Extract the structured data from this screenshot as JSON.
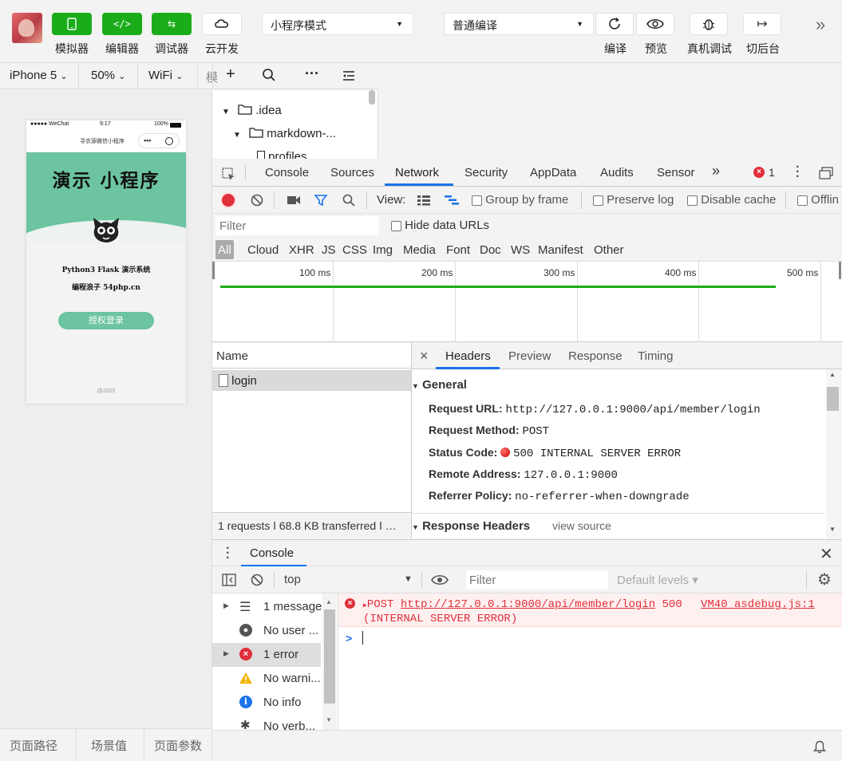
{
  "toolbar": {
    "buttons": [
      {
        "label": "模拟器",
        "icon": "phone-icon"
      },
      {
        "label": "编辑器",
        "icon": "code-icon"
      },
      {
        "label": "调试器",
        "icon": "sliders-icon"
      },
      {
        "label": "云开发",
        "icon": "cloud-icon"
      }
    ],
    "mode_select": "小程序模式",
    "compile_select": "普通编译",
    "actions": [
      {
        "label": "编译",
        "icon": "refresh-icon"
      },
      {
        "label": "预览",
        "icon": "eye-icon"
      },
      {
        "label": "真机调试",
        "icon": "bug-icon"
      },
      {
        "label": "切后台",
        "icon": "switch-icon"
      }
    ],
    "more": "»"
  },
  "device_bar": {
    "device": "iPhone 5",
    "zoom": "50%",
    "network": "WiFi",
    "cut": "模"
  },
  "simulator": {
    "status_left": "●●●●● WeChat",
    "status_time": "9:17",
    "status_right": "100%",
    "nav_title": "寻衣源微信小程序",
    "app_title": "演示 小程序",
    "line1": "Python3 Flask 演示系统",
    "line2": "编程浪子 54php.cn",
    "login_button": "授权登录",
    "footer": "@2020"
  },
  "sim_bottom": [
    "页面路径",
    "场景值",
    "页面参数"
  ],
  "file_tree": [
    ".idea",
    "markdown-...",
    "profiles"
  ],
  "devtools_tabs": [
    "Console",
    "Sources",
    "Network",
    "Security",
    "AppData",
    "Audits",
    "Sensor"
  ],
  "devtools_more": "»",
  "error_count": "1",
  "network": {
    "view_label": "View:",
    "group_by_frame": "Group by frame",
    "preserve_log": "Preserve log",
    "disable_cache": "Disable cache",
    "offline": "Offlin",
    "filter_placeholder": "Filter",
    "hide_data_urls": "Hide data URLs",
    "types": [
      "All",
      "Cloud",
      "XHR",
      "JS",
      "CSS",
      "Img",
      "Media",
      "Font",
      "Doc",
      "WS",
      "Manifest",
      "Other"
    ],
    "timeline_ticks": [
      "100 ms",
      "200 ms",
      "300 ms",
      "400 ms",
      "500 ms"
    ],
    "name_header": "Name",
    "requests": [
      "login"
    ],
    "summary": "1 requests  ǀ  68.8 KB transferred  ǀ  …"
  },
  "detail": {
    "close": "×",
    "tabs": [
      "Headers",
      "Preview",
      "Response",
      "Timing"
    ],
    "general_title": "General",
    "rows": [
      {
        "label": "Request URL:",
        "value": "http://127.0.0.1:9000/api/member/login"
      },
      {
        "label": "Request Method:",
        "value": "POST"
      },
      {
        "label": "Status Code:",
        "value": "500 INTERNAL SERVER ERROR"
      },
      {
        "label": "Remote Address:",
        "value": "127.0.0.1:9000"
      },
      {
        "label": "Referrer Policy:",
        "value": "no-referrer-when-downgrade"
      }
    ],
    "response_headers": "Response Headers",
    "view_source": "view source"
  },
  "console": {
    "drawer_tab": "Console",
    "context": "top",
    "filter_placeholder": "Filter",
    "levels": "Default levels ▾",
    "sidebar": [
      {
        "label": "1 message",
        "icon": "list-icon"
      },
      {
        "label": "No user ...",
        "icon": "user-icon"
      },
      {
        "label": "1 error",
        "icon": "error-icon"
      },
      {
        "label": "No warni...",
        "icon": "warning-icon"
      },
      {
        "label": "No info",
        "icon": "info-icon"
      },
      {
        "label": "No verb...",
        "icon": "bug-small-icon"
      }
    ],
    "error_method": "POST",
    "error_url": "http://127.0.0.1:9000/api/member/login",
    "error_code": "500",
    "error_status": "(INTERNAL SERVER ERROR)",
    "error_source": "VM40 asdebug.js:1",
    "prompt": ">"
  },
  "colors": {
    "green": "#1aad19",
    "accent": "#1a73e8",
    "error": "#e0303a",
    "error_bg": "#fff0f0",
    "hero": "#6cc4a1"
  }
}
